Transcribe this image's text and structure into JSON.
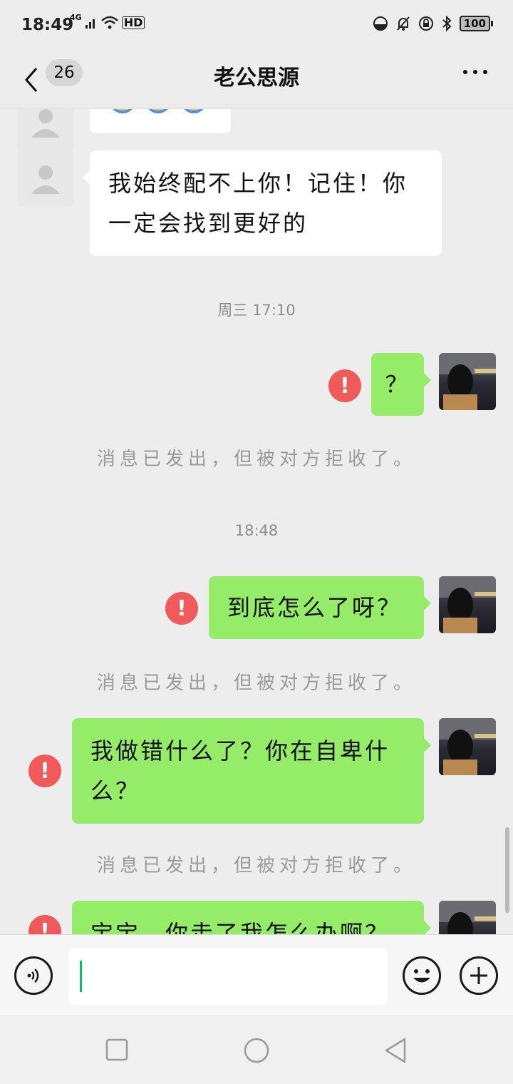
{
  "status_bar": {
    "time": "18:49",
    "network": "4G",
    "hd": "HD",
    "battery": "100"
  },
  "header": {
    "unread_count": "26",
    "title": "老公思源"
  },
  "messages": [
    {
      "type": "incoming",
      "text": "我始终配不上你！记住！你一定会找到更好的"
    },
    {
      "type": "timestamp",
      "text": "周三 17:10"
    },
    {
      "type": "outgoing",
      "text": "？",
      "status": "failed"
    },
    {
      "type": "system",
      "text": "消息已发出，但被对方拒收了。"
    },
    {
      "type": "timestamp",
      "text": "18:48"
    },
    {
      "type": "outgoing",
      "text": "到底怎么了呀？",
      "status": "failed"
    },
    {
      "type": "system",
      "text": "消息已发出，但被对方拒收了。"
    },
    {
      "type": "outgoing",
      "text": "我做错什么了？你在自卑什么？",
      "status": "failed"
    },
    {
      "type": "system",
      "text": "消息已发出，但被对方拒收了。"
    },
    {
      "type": "outgoing",
      "text": "宝宝，你走了我怎么办啊？",
      "status": "failed"
    }
  ],
  "input": {
    "value": ""
  },
  "colors": {
    "outgoing_bubble": "#95ec69",
    "incoming_bubble": "#ffffff",
    "failed_icon": "#f05a5a",
    "caret": "#07c160"
  },
  "icons": [
    "back-arrow-icon",
    "more-icon",
    "voice-icon",
    "emoji-icon",
    "plus-icon",
    "fail-icon",
    "default-avatar-icon",
    "nav-recents-icon",
    "nav-home-icon",
    "nav-back-icon"
  ]
}
